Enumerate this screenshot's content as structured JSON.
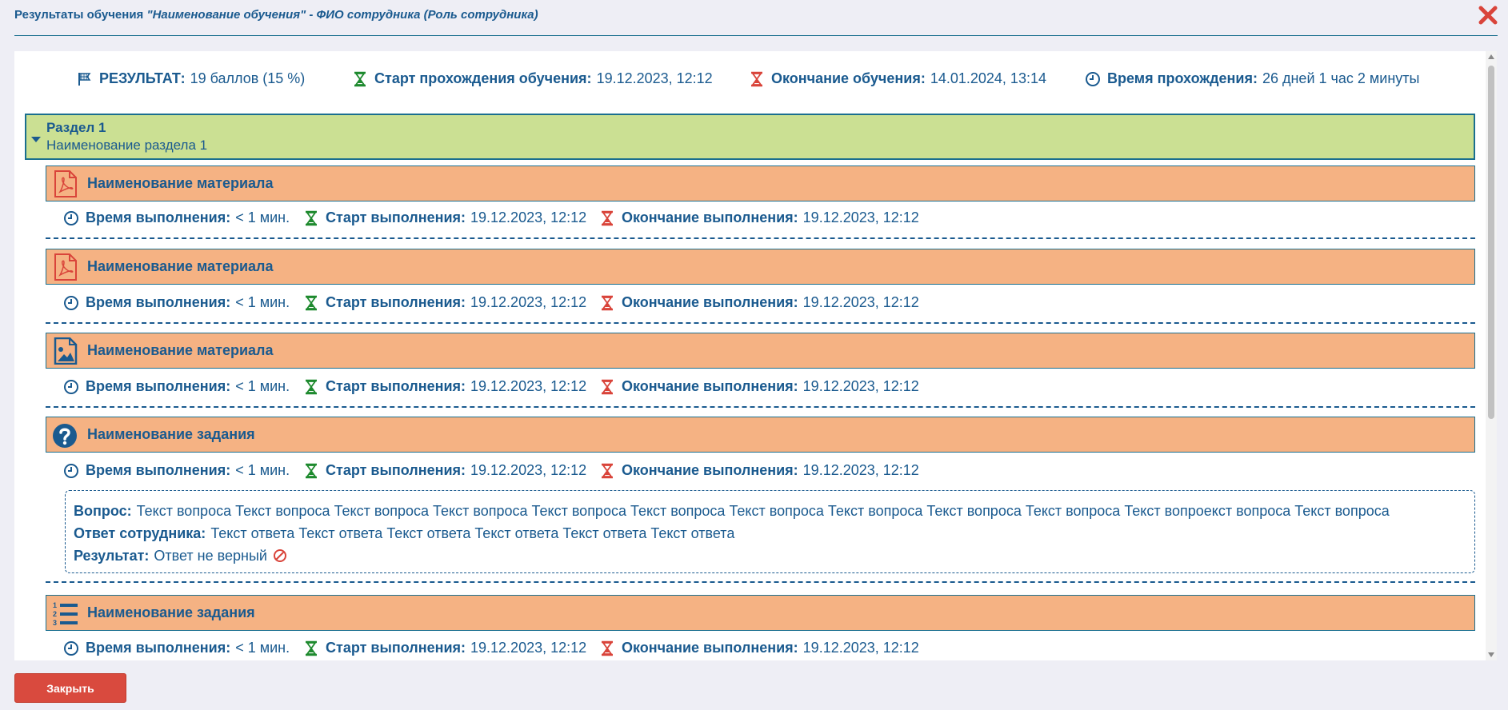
{
  "dialog": {
    "title_prefix": "Результаты обучения ",
    "title_course": "\"Наименование обучения\"",
    "title_sep": "  - ",
    "title_person": "ФИО сотрудника (Роль сотрудника)",
    "close_icon": "close-x-icon",
    "close_button_label": "Закрыть"
  },
  "summary": {
    "result_label": "РЕЗУЛЬТАТ:",
    "result_value": "19 баллов (15 %)",
    "start_label": "Старт прохождения обучения:",
    "start_value": "19.12.2023, 12:12",
    "end_label": "Окончание обучения:",
    "end_value": "14.01.2024, 13:14",
    "duration_label": "Время прохождения:",
    "duration_value": "26 дней 1 час 2 минуты"
  },
  "section": {
    "title": "Раздел 1",
    "subtitle": "Наименование раздела 1"
  },
  "meta_labels": {
    "time": "Время выполнения:",
    "start": "Старт выполнения:",
    "end": "Окончание выполнения:"
  },
  "items": [
    {
      "type": "pdf",
      "name": "Наименование материала",
      "time": "< 1 мин.",
      "start": "19.12.2023, 12:12",
      "end": "19.12.2023, 12:12"
    },
    {
      "type": "pdf",
      "name": "Наименование материала",
      "time": "< 1 мин.",
      "start": "19.12.2023, 12:12",
      "end": "19.12.2023, 12:12"
    },
    {
      "type": "image",
      "name": "Наименование материала",
      "time": "< 1 мин.",
      "start": "19.12.2023, 12:12",
      "end": "19.12.2023, 12:12"
    },
    {
      "type": "question",
      "name": "Наименование задания",
      "time": "< 1 мин.",
      "start": "19.12.2023, 12:12",
      "end": "19.12.2023, 12:12",
      "question_label": "Вопрос:",
      "question_text": "Текст вопроса Текст вопроса Текст вопроса Текст вопроса Текст вопроса Текст вопроса Текст вопроса Текст вопроса Текст вопроса Текст вопроса Текст вопроекст вопроса Текст вопроса",
      "answer_label": "Ответ сотрудника:",
      "answer_text": "Текст ответа Текст ответа Текст ответа Текст ответа Текст ответа Текст ответа",
      "result_label": "Результат:",
      "result_text": "Ответ не верный"
    },
    {
      "type": "ordered-list",
      "name": "Наименование задания",
      "time": "< 1 мин.",
      "start": "19.12.2023, 12:12",
      "end": "19.12.2023, 12:12"
    }
  ],
  "colors": {
    "primary": "#1a5a8f",
    "section_bg": "#cbe093",
    "item_bg": "#f5b283",
    "start_icon": "#1e8a2e",
    "end_icon": "#d9443a",
    "close_button": "#d94a3e"
  }
}
